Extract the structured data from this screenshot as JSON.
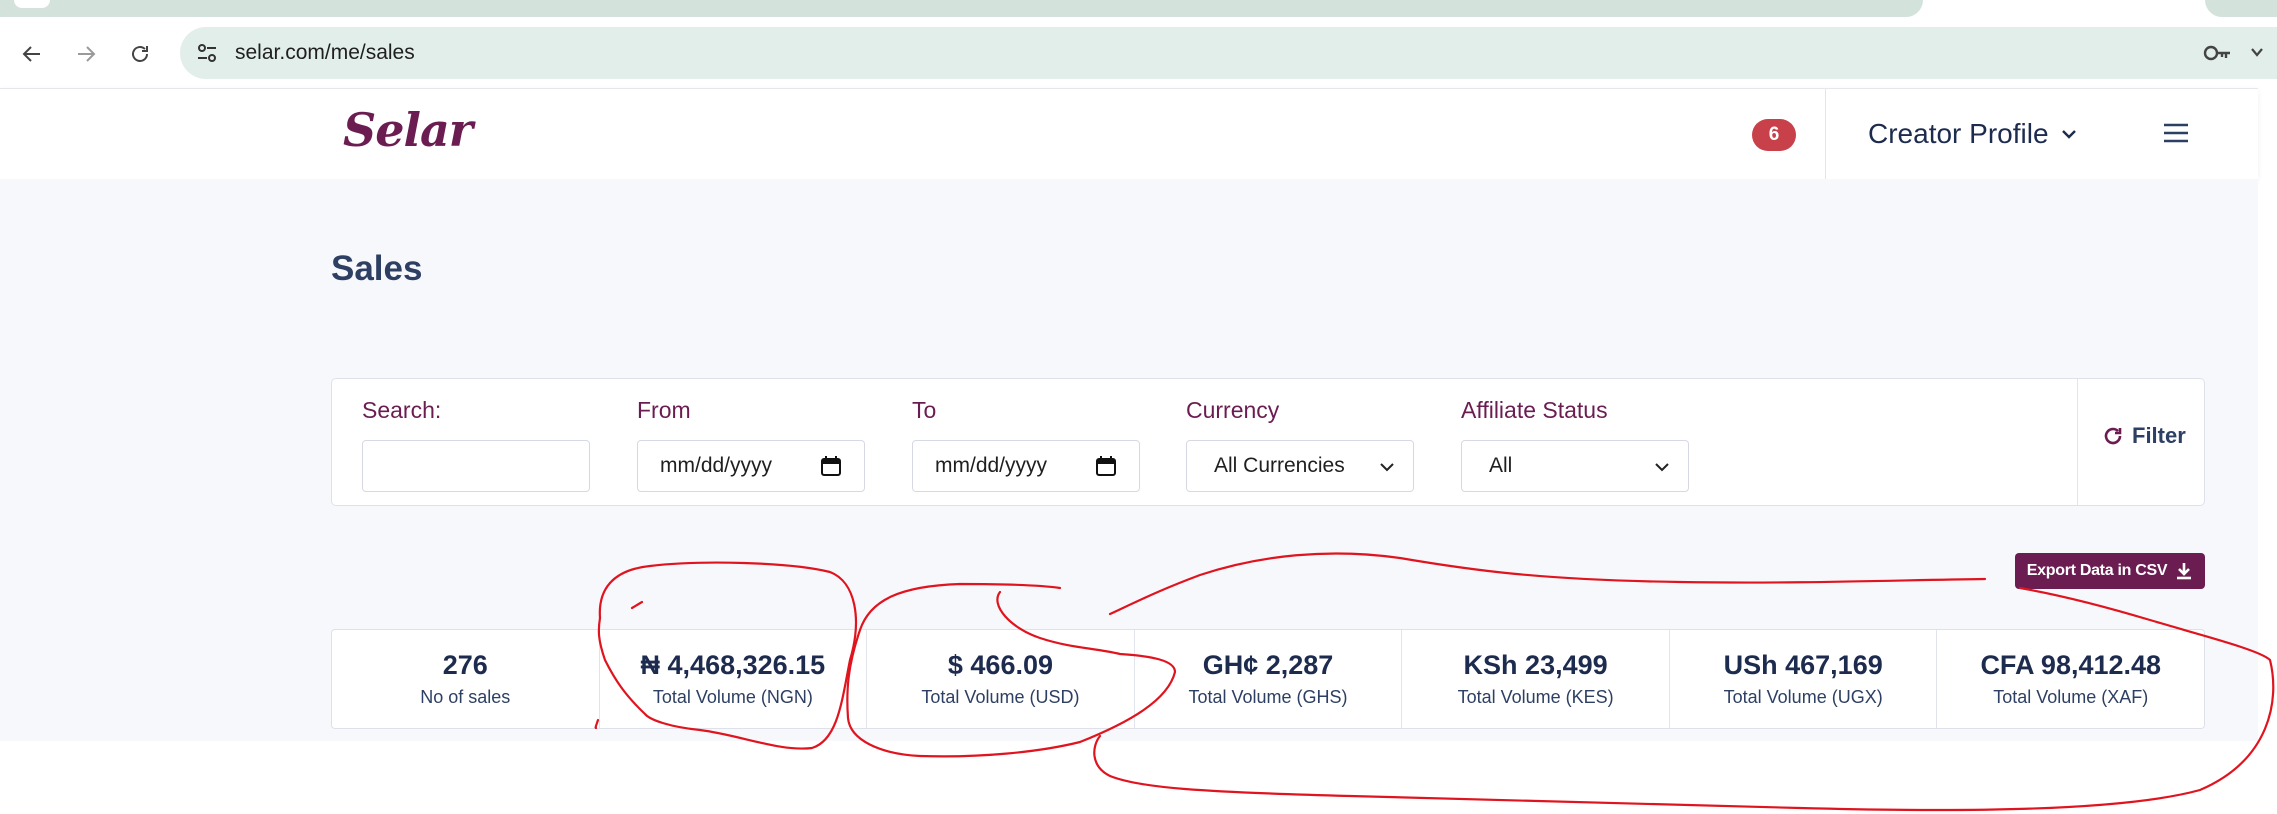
{
  "browser": {
    "url": "selar.com/me/sales",
    "icons": [
      "back-arrow-icon",
      "forward-arrow-icon",
      "reload-icon",
      "site-settings-icon",
      "key-icon",
      "more-icon"
    ]
  },
  "header": {
    "logo_text": "Selar",
    "notification_count": "6",
    "profile_label": "Creator Profile",
    "brand_color": "#6b1d52",
    "badge_color": "#c8404a"
  },
  "page": {
    "title": "Sales"
  },
  "filters": {
    "search_label": "Search:",
    "search_value": "",
    "from_label": "From",
    "from_value": "mm/dd/yyyy",
    "to_label": "To",
    "to_value": "mm/dd/yyyy",
    "currency_label": "Currency",
    "currency_value": "All Currencies",
    "affiliate_label": "Affiliate Status",
    "affiliate_value": "All",
    "filter_button": "Filter"
  },
  "export_button": "Export Data in CSV",
  "stats": [
    {
      "value": "276",
      "label": "No of sales"
    },
    {
      "value": "₦ 4,468,326.15",
      "label": "Total Volume (NGN)"
    },
    {
      "value": "$ 466.09",
      "label": "Total Volume (USD)"
    },
    {
      "value": "GH¢ 2,287",
      "label": "Total Volume (GHS)"
    },
    {
      "value": "KSh 23,499",
      "label": "Total Volume (KES)"
    },
    {
      "value": "USh 467,169",
      "label": "Total Volume (UGX)"
    },
    {
      "value": "CFA 98,412.48",
      "label": "Total Volume (XAF)"
    }
  ],
  "annotation_color": "#e0141e"
}
